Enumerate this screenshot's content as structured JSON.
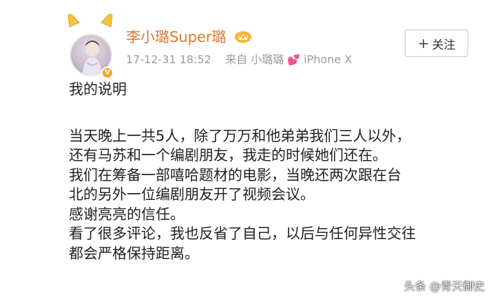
{
  "author": {
    "name": "李小璐Super璐",
    "badge_icon": "crown-badge-icon",
    "verified_icon": "verified-badge-icon",
    "name_color": "#e2762d"
  },
  "meta": {
    "timestamp": "17-12-31 18:52",
    "source_prefix": "来自",
    "source_name": "小璐璐",
    "source_heart": "💕",
    "device": "iPhone X"
  },
  "follow_button": {
    "plus": "+",
    "label": "关注"
  },
  "content": {
    "title": "我的说明",
    "lines": [
      "当天晚上一共5人，除了万万和他弟弟我们三人以外，",
      "还有马苏和一个编剧朋友，我走的时候她们还在。",
      "我们在筹备一部嘻哈题材的电影，当晚还两次跟在台",
      "北的另外一位编剧朋友开了视频会议。",
      "感谢亮亮的信任。",
      "看了很多评论，我也反省了自己，以后与任何异性交往",
      "都会严格保持距离。"
    ]
  },
  "watermark": "头条 @青天御史"
}
